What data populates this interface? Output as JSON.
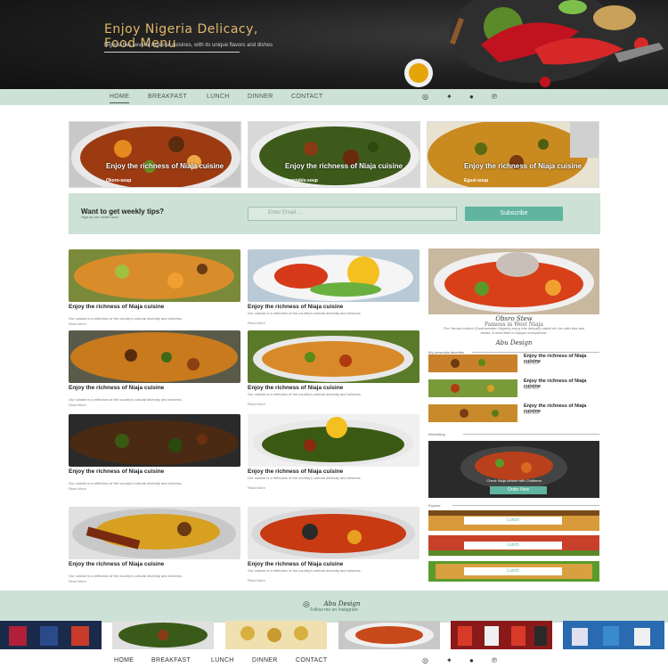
{
  "hero": {
    "title_line1": "Enjoy Nigeria Delicacy,",
    "title_line2": "Food Menu",
    "subtitle": "Nigeria has several regional cuisines, with its unique flavors and dishes"
  },
  "nav": {
    "items": [
      "HOME",
      "BREAKFAST",
      "LUNCH",
      "DINNER",
      "CONTACT"
    ],
    "social_icons": [
      "instagram-icon",
      "twitter-icon",
      "facebook-icon",
      "pinterest-icon"
    ]
  },
  "featured": [
    {
      "title": "Enjoy the richness of Niaja cuisine",
      "subtitle": "Okoro-soup"
    },
    {
      "title": "Enjoy the richness of Niaja cuisine",
      "subtitle": "Vegetable-soup"
    },
    {
      "title": "Enjoy the richness of Niaja cuisine",
      "subtitle": "Egusi-soup"
    }
  ],
  "tips": {
    "heading": "Want to get weekly tips?",
    "subheading": "Sign up our create food",
    "email_placeholder": "Enter Email ....",
    "button": "Subscribe"
  },
  "grid": {
    "title": "Enjoy the richness of Niaja cuisine",
    "desc": "Our cuisine is a reflection of the country's cultural diversity and richness.",
    "read_more": "Read More"
  },
  "sidebar": {
    "feature_title": "Obsro Stew",
    "feature_subtitle": "Famous in West Niaja",
    "feature_text": "The Yoruba cuisine (Southwestern Nigeria) enjoy this delicacy called efo riro with eba and amala. A meal that is enjoyed everywhere.",
    "author": "Abu Design",
    "favorites_label": "My personals favorites",
    "favorites": [
      {
        "title": "Enjoy the richness of Niaja cuisine",
        "read": "Read More"
      },
      {
        "title": "Enjoy the richness of Niaja cuisine",
        "read": "Read More"
      },
      {
        "title": "Enjoy the richness of Niaja cuisine",
        "read": "Read More"
      }
    ],
    "interesting_label": "Interesting",
    "promo_text": "Check Niaja cuisine with Chidinma",
    "promo_button": "Order Now",
    "explore_label": "Explore",
    "explore_buttons": [
      "Lunch",
      "Lunch",
      "Lunch"
    ]
  },
  "footer": {
    "brand": "Abu Design",
    "follow": "Follow me on Instagram",
    "nav": [
      "HOME",
      "BREAKFAST",
      "LUNCH",
      "DINNER",
      "CONTACT"
    ]
  },
  "colors": {
    "mint": "#cde1d6",
    "accent": "#5fb59f",
    "gold": "#e0b86a",
    "dark": "#1e1e1e"
  }
}
